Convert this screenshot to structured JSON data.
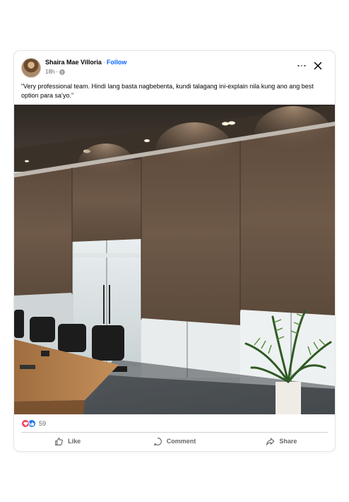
{
  "post": {
    "author": "Shaira Mae Villoria",
    "separator": "·",
    "follow_label": "Follow",
    "time": "18h",
    "caption": "“Very professional team. Hindi lang basta nagbebenta, kundi talagang ini-explain nila kung ano ang best option para sa’yo.”"
  },
  "reactions": {
    "count": "59",
    "types": [
      "love-icon",
      "like-icon"
    ]
  },
  "actions": {
    "like_label": "Like",
    "comment_label": "Comment",
    "share_label": "Share"
  },
  "icons": [
    "globe-icon",
    "more-icon",
    "close-icon",
    "thumbs-up-icon",
    "comment-icon",
    "share-icon"
  ],
  "colors": {
    "link_blue": "#0866ff",
    "secondary_text": "#65676b",
    "love_red": "#f33e58",
    "like_blue": "#1877f2"
  }
}
